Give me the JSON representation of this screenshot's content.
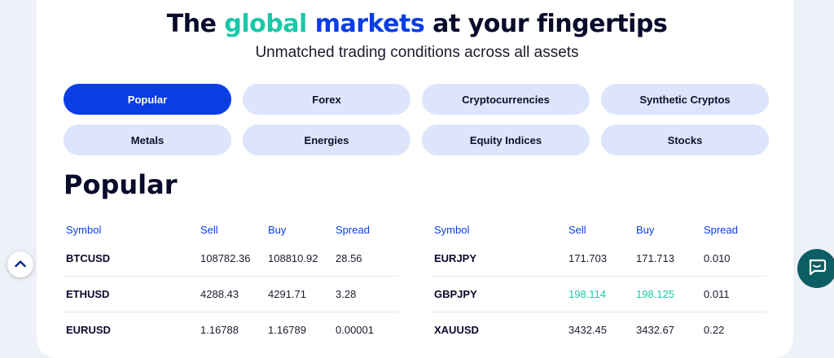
{
  "hero": {
    "title_part1": "The ",
    "title_part2": "global",
    "title_part3": " markets",
    "title_part4": " at your fingertips",
    "subtitle": "Unmatched trading conditions across all assets"
  },
  "tabs": [
    {
      "label": "Popular",
      "active": true
    },
    {
      "label": "Forex"
    },
    {
      "label": "Cryptocurrencies"
    },
    {
      "label": "Synthetic Cryptos"
    },
    {
      "label": "Metals"
    },
    {
      "label": "Energies"
    },
    {
      "label": "Equity Indices"
    },
    {
      "label": "Stocks"
    }
  ],
  "section_title": "Popular",
  "table_headers": {
    "symbol": "Symbol",
    "sell": "Sell",
    "buy": "Buy",
    "spread": "Spread"
  },
  "left_table": [
    {
      "symbol": "BTCUSD",
      "sell": "108782.36",
      "buy": "108810.92",
      "spread": "28.56"
    },
    {
      "symbol": "ETHUSD",
      "sell": "4288.43",
      "buy": "4291.71",
      "spread": "3.28"
    },
    {
      "symbol": "EURUSD",
      "sell": "1.16788",
      "buy": "1.16789",
      "spread": "0.00001"
    }
  ],
  "right_table": [
    {
      "symbol": "EURJPY",
      "sell": "171.703",
      "buy": "171.713",
      "spread": "0.010"
    },
    {
      "symbol": "GBPJPY",
      "sell": "198.114",
      "buy": "198.125",
      "spread": "0.011"
    },
    {
      "symbol": "XAUUSD",
      "sell": "3432.45",
      "buy": "3432.67",
      "spread": "0.22"
    }
  ],
  "icons": {
    "scroll_top": "chevron-up-icon",
    "chat": "chat-bubble-icon"
  },
  "colors": {
    "accent": "#0a3de3",
    "highlight": "#19c8a8",
    "tab_bg": "#dce5fb",
    "chat_bg": "#0b5e63"
  }
}
